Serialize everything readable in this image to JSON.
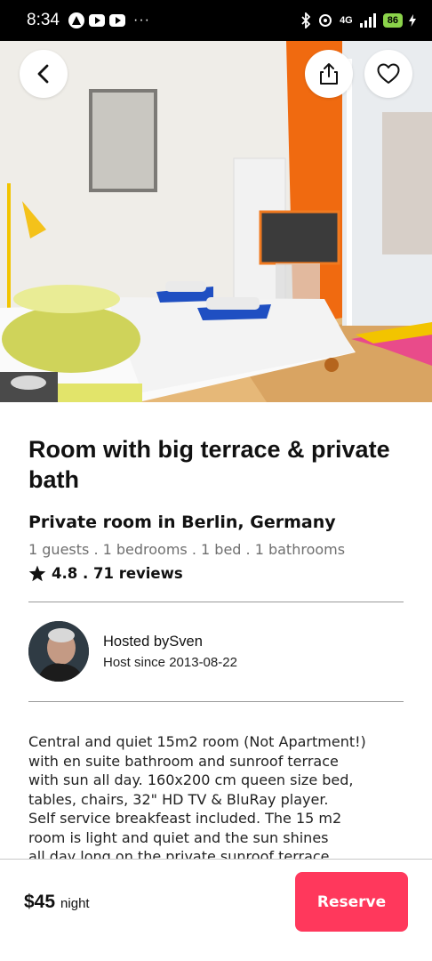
{
  "status_bar": {
    "time": "8:34",
    "dots": "···",
    "network": "4G",
    "battery": "86"
  },
  "listing": {
    "title": "Room with big terrace & private bath",
    "subtitle": "Private room in Berlin, Germany",
    "details": "1 guests . 1 bedrooms . 1 bed .  1 bathrooms",
    "rating": "4.8 . 71 reviews",
    "description": "Central and quiet 15m2 room (Not Apartment!)\nwith en suite bathroom and sunroof terrace\nwith sun all day. 160x200 cm queen size bed,\ntables, chairs,  32\" HD TV & BluRay player.\nSelf service breakfeast included. The 15 m2\nroom is light and quiet and the sun shines\nall day long on the private sunroof terrace"
  },
  "host": {
    "hosted_by": "Hosted bySven",
    "since": "Host since 2013-08-22"
  },
  "booking": {
    "price": "$45",
    "unit": "night",
    "reserve_label": "Reserve"
  },
  "colors": {
    "accent": "#ff385c",
    "divider": "#9a9a9a"
  },
  "icons": {
    "back": "arrow-left-icon",
    "share": "share-icon",
    "favorite": "heart-icon",
    "rating": "star-icon"
  }
}
